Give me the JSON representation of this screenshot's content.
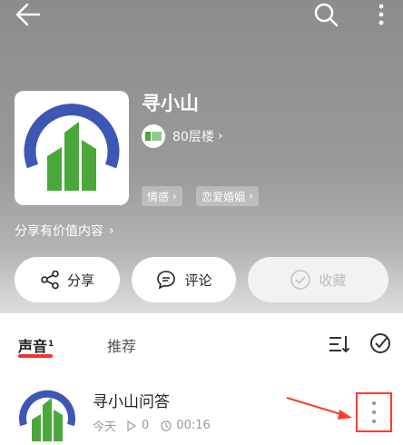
{
  "album": {
    "title": "寻小山",
    "floors": "80层楼",
    "tags": [
      "情感",
      "恋爱婚姻"
    ],
    "subtitle": "分享有价值内容"
  },
  "actions": {
    "share": "分享",
    "comment": "评论",
    "collect": "收藏"
  },
  "tabs": {
    "sound": "声音",
    "sound_count": "1",
    "recommend": "推荐"
  },
  "tracks": [
    {
      "title": "寻小山问答",
      "date": "今天",
      "plays": "0",
      "duration": "00:16"
    }
  ],
  "colors": {
    "accent_red": "#ff3b2f",
    "logo_blue": "#3c57b5",
    "logo_green": "#4aa83a"
  },
  "icons": {
    "back": "arrow-left-icon",
    "search": "search-icon",
    "more": "more-vertical-icon",
    "share": "share-icon",
    "comment": "comment-icon",
    "collect": "check-circle-icon",
    "sort": "sort-icon",
    "multiselect": "check-icon"
  }
}
